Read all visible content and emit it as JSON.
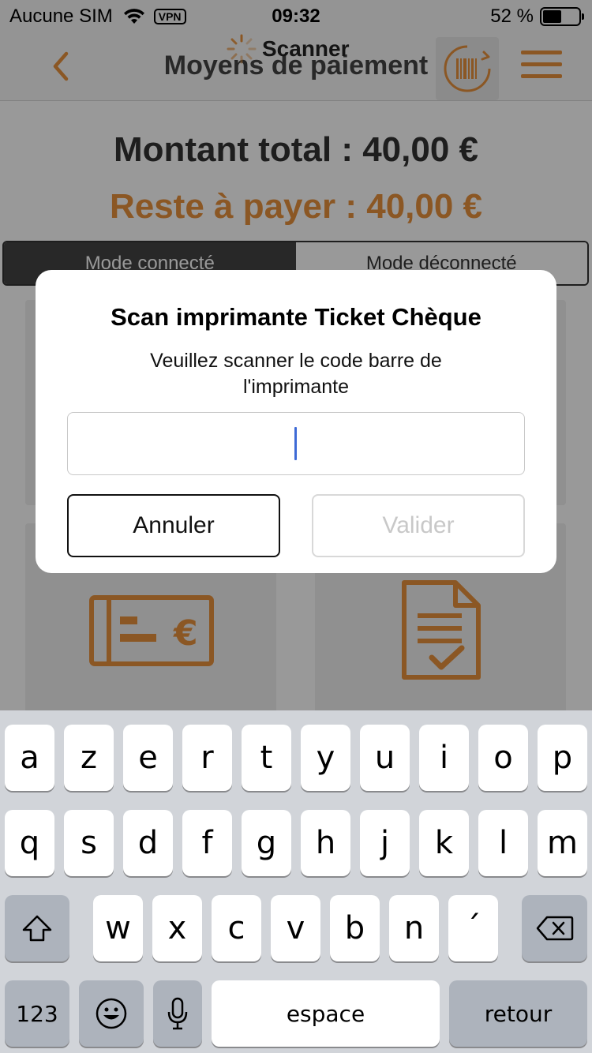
{
  "status_bar": {
    "carrier": "Aucune SIM",
    "vpn": "VPN",
    "time": "09:32",
    "battery": "52 %",
    "battery_level": 0.52
  },
  "nav": {
    "title": "Moyens de paiement",
    "scanner_label": "Scanner"
  },
  "totals": {
    "total": "Montant total : 40,00 €",
    "remaining": "Reste à payer : 40,00 €"
  },
  "mode_toggle": {
    "connected": "Mode connecté",
    "disconnected": "Mode déconnecté"
  },
  "dialog": {
    "title": "Scan imprimante Ticket Chèque",
    "message": "Veuillez scanner le code barre de l'imprimante",
    "input_value": "",
    "cancel_label": "Annuler",
    "validate_label": "Valider"
  },
  "keyboard": {
    "row1": [
      "a",
      "z",
      "e",
      "r",
      "t",
      "y",
      "u",
      "i",
      "o",
      "p"
    ],
    "row2": [
      "q",
      "s",
      "d",
      "f",
      "g",
      "h",
      "j",
      "k",
      "l",
      "m"
    ],
    "row3": [
      "w",
      "x",
      "c",
      "v",
      "b",
      "n",
      "´"
    ],
    "numbers_label": "123",
    "space_label": "espace",
    "return_label": "retour"
  },
  "colors": {
    "accent": "#e8923c",
    "caret": "#3e6ad6"
  }
}
